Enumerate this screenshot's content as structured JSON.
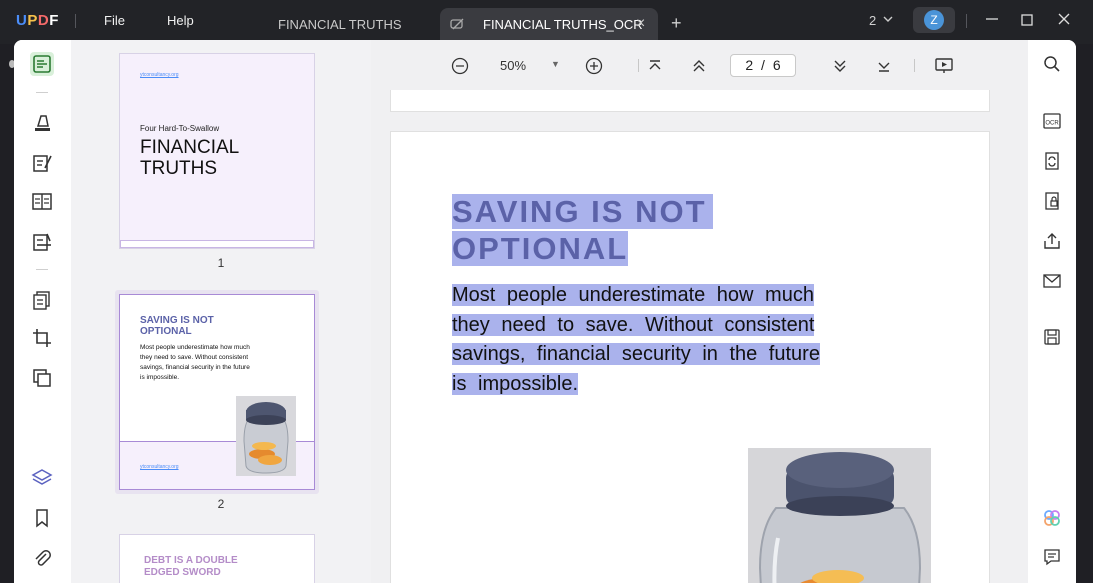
{
  "app": {
    "logo": "UPDF",
    "menu": {
      "file": "File",
      "help": "Help"
    },
    "tabs": [
      {
        "label": "FINANCIAL TRUTHS",
        "active": false
      },
      {
        "label": "FINANCIAL TRUTHS_OCR",
        "active": true
      }
    ],
    "tab_add": "+",
    "tab_close": "×",
    "window_count": "2",
    "user_initial": "Z"
  },
  "toolbar": {
    "zoom": "50%",
    "current_page": "2",
    "total_pages": "6",
    "page_separator": "/"
  },
  "thumbnails": [
    {
      "number": "1",
      "url": "ytconsultancy.org",
      "subtitle": "Four Hard-To-Swallow",
      "title_line1": "FINANCIAL",
      "title_line2": "TRUTHS"
    },
    {
      "number": "2",
      "heading_line1": "SAVING IS NOT",
      "heading_line2": "OPTIONAL",
      "body_lines": [
        "Most people underestimate how much",
        "they need to save. Without consistent",
        "savings, financial security in the future",
        "is impossible."
      ],
      "url": "ytconsultancy.org"
    },
    {
      "heading_line1": "DEBT IS A DOUBLE",
      "heading_line2": "EDGED SWORD"
    }
  ],
  "page": {
    "heading_line1": "SAVING IS NOT",
    "heading_line2": "OPTIONAL",
    "body_lines": [
      "Most people underestimate how much",
      "they need to save. Without consistent",
      "savings, financial security in the future",
      "is impossible."
    ]
  },
  "colors": {
    "accent": "#5b62a8",
    "highlight": "#aab2ec",
    "thumb_bg": "#f6f0fc",
    "link": "#4b8df8"
  }
}
